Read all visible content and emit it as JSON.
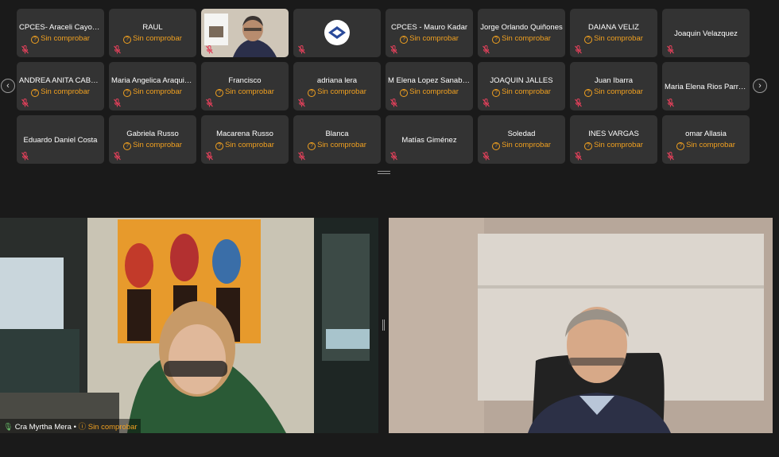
{
  "status_label": "Sin comprobar",
  "participants": [
    {
      "name": "CPCES- Araceli Cayo B...",
      "status": "Sin comprobar"
    },
    {
      "name": "RAUL",
      "status": "Sin comprobar"
    },
    {
      "name": "",
      "status": "",
      "video": true
    },
    {
      "name": "",
      "status": "",
      "logo": true
    },
    {
      "name": "CPCES - Mauro Kadar",
      "status": "Sin comprobar"
    },
    {
      "name": "Jorge Orlando Quiñones",
      "status": "Sin comprobar"
    },
    {
      "name": "DAIANA VELIZ",
      "status": "Sin comprobar"
    },
    {
      "name": "Joaquin Velazquez",
      "status": ""
    },
    {
      "name": "ANDREA ANITA CABEZ...",
      "status": "Sin comprobar"
    },
    {
      "name": "Maria Angelica Araquis...",
      "status": "Sin comprobar"
    },
    {
      "name": "Francisco",
      "status": "Sin comprobar"
    },
    {
      "name": "adriana lera",
      "status": "Sin comprobar"
    },
    {
      "name": "M Elena Lopez Sanabria",
      "status": "Sin comprobar"
    },
    {
      "name": "JOAQUIN JALLES",
      "status": "Sin comprobar"
    },
    {
      "name": "Juan Ibarra",
      "status": "Sin comprobar"
    },
    {
      "name": "Maria Elena Rios Parraga",
      "status": ""
    },
    {
      "name": "Eduardo Daniel Costa",
      "status": ""
    },
    {
      "name": "Gabriela Russo",
      "status": "Sin comprobar"
    },
    {
      "name": "Macarena Russo",
      "status": "Sin comprobar"
    },
    {
      "name": "Blanca",
      "status": "Sin comprobar"
    },
    {
      "name": "Matías Giménez",
      "status": ""
    },
    {
      "name": "Soledad",
      "status": "Sin comprobar"
    },
    {
      "name": "INES VARGAS",
      "status": "Sin comprobar"
    },
    {
      "name": "omar Allasia",
      "status": "Sin comprobar"
    }
  ],
  "nav": {
    "prev_icon": "‹",
    "next_icon": "›"
  },
  "speakers": [
    {
      "name": "Cra Myrtha Mera",
      "status": "Sin comprobar"
    },
    {
      "name": "",
      "status": ""
    }
  ],
  "colors": {
    "status": "#f0a020",
    "tile": "#333333",
    "mic_off": "#e0405a",
    "background": "#1a1a1a"
  }
}
